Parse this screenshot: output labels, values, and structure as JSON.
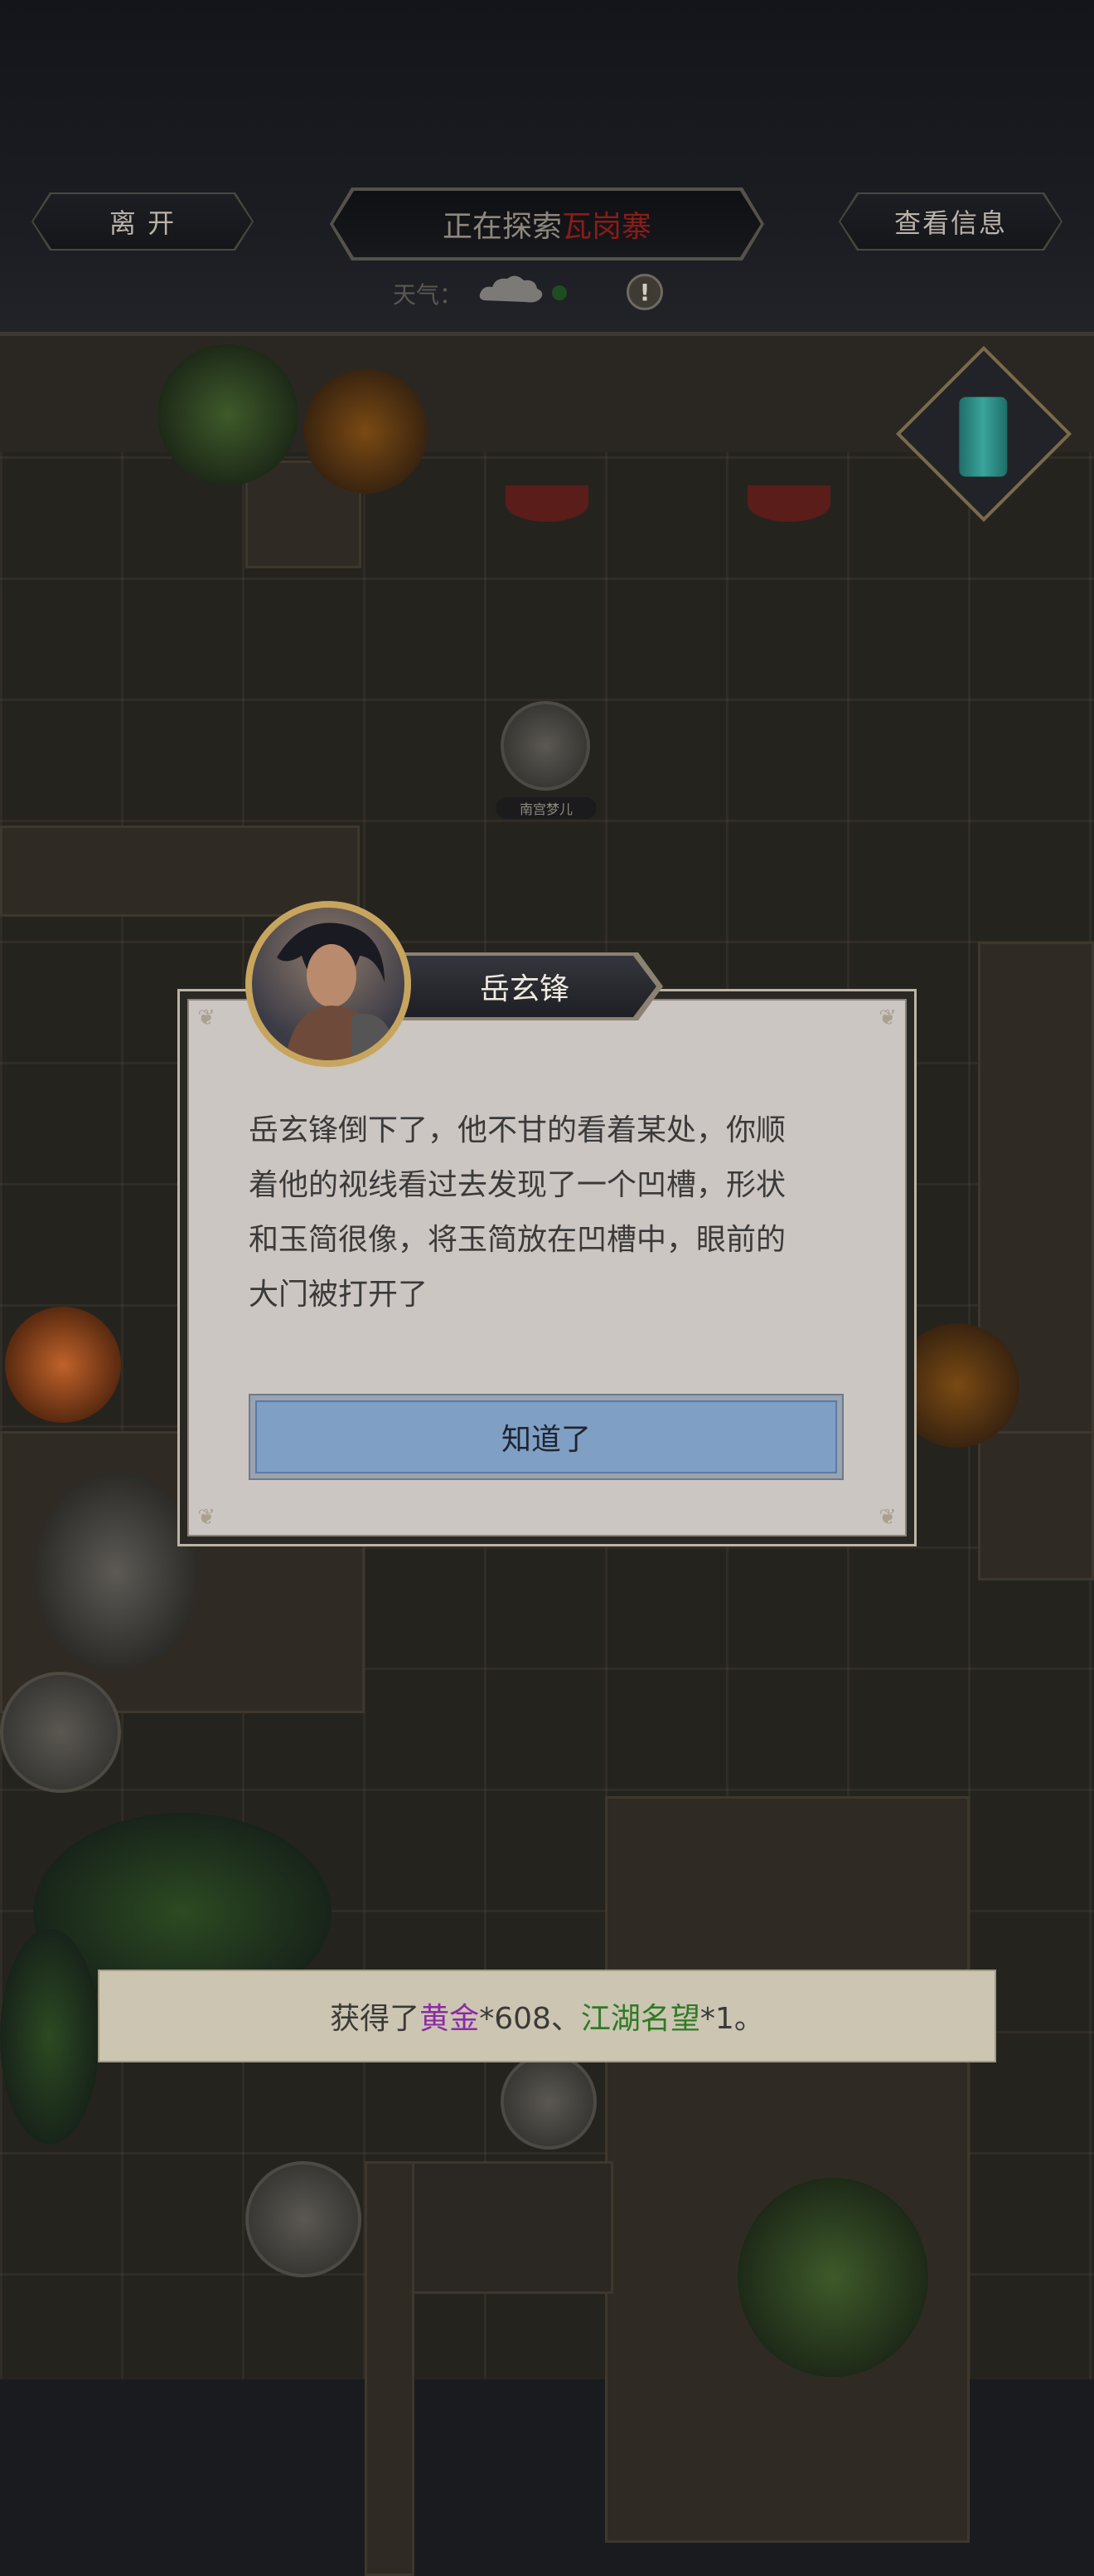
{
  "header": {
    "leave_label": "离 开",
    "exploring_prefix": "正在探索",
    "location_name": "瓦岗寨",
    "info_label": "查看信息",
    "weather_label": "天气：",
    "weather_icon": "cloud-icon",
    "info_icon_glyph": "!"
  },
  "map": {
    "npc_labels": [
      "南宫梦儿",
      ""
    ]
  },
  "dialog": {
    "speaker": "岳玄锋",
    "message_lines": [
      "岳玄锋倒下了，他不甘的看着某处，你顺",
      "着他的视线看过去发现了一个凹槽，形状",
      "和玉简很像，将玉简放在凹槽中，眼前的",
      "大门被打开了"
    ],
    "confirm_label": "知道了"
  },
  "toast": {
    "prefix": "获得了",
    "item1": "黄金",
    "item1_qty": "*608、",
    "item2": "江湖名望",
    "item2_qty": "*1。"
  },
  "colors": {
    "location": "#8a1c18",
    "gold_item": "#8d2aa5",
    "reputation_item": "#2f7a24",
    "confirm_button": "#7f9fc4"
  }
}
